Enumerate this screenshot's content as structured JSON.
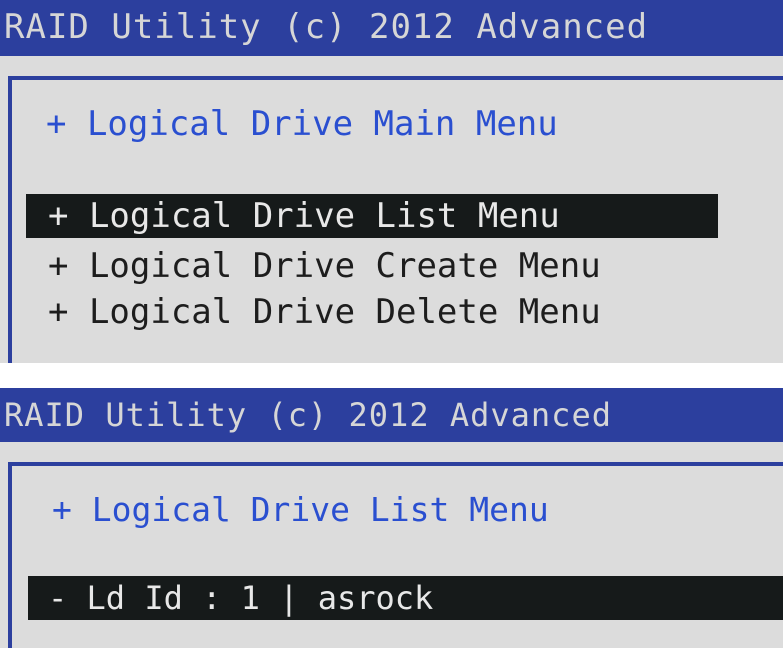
{
  "screen_top": {
    "title": "RAID Utility (c) 2012 Advanced",
    "menu_heading": "+ Logical Drive Main Menu",
    "items": [
      {
        "label": "+ Logical Drive List Menu",
        "selected": true
      },
      {
        "label": "+ Logical Drive Create Menu",
        "selected": false
      },
      {
        "label": "+ Logical Drive Delete Menu",
        "selected": false
      }
    ]
  },
  "screen_bottom": {
    "title": "RAID Utility (c) 2012 Advanced",
    "menu_heading": "+ Logical Drive List Menu",
    "ld_row": "- Ld Id : 1 | asrock"
  },
  "colors": {
    "title_bar": "#2c3f9e",
    "title_text": "#d6d6d6",
    "background": "#dcdcdc",
    "heading_text": "#2a4fd0",
    "selected_bg": "#161a1a",
    "selected_text": "#e8e8e8"
  }
}
